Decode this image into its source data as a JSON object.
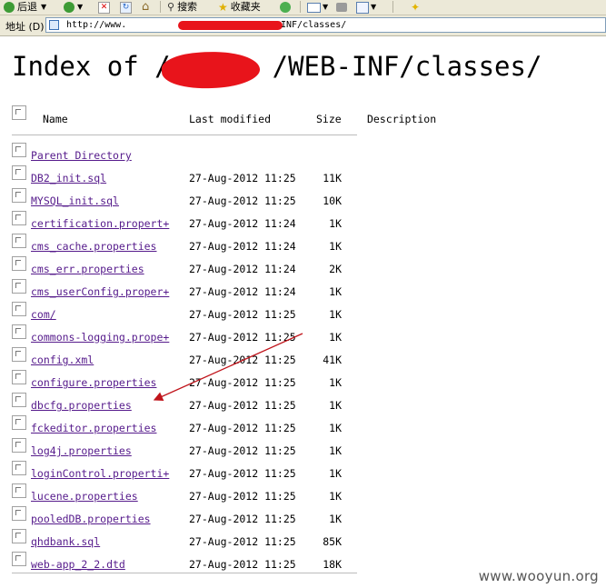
{
  "toolbar": {
    "back_label": "后退",
    "search_label": "搜索",
    "favorites_label": "收藏夹"
  },
  "address_bar": {
    "label": "地址 (D)",
    "url_prefix": "http://www.",
    "url_suffix": "INF/classes/"
  },
  "page": {
    "heading_prefix": "Index of /",
    "heading_suffix": "/WEB-INF/classes/"
  },
  "columns": {
    "name": "Name",
    "last_modified": "Last modified",
    "size": "Size",
    "description": "Description"
  },
  "files": [
    {
      "name": "Parent Directory",
      "modified": "",
      "size": ""
    },
    {
      "name": "DB2_init.sql",
      "modified": "27-Aug-2012 11:25",
      "size": "11K"
    },
    {
      "name": "MYSQL_init.sql",
      "modified": "27-Aug-2012 11:25",
      "size": "10K"
    },
    {
      "name": "certification.propert+",
      "modified": "27-Aug-2012 11:24",
      "size": "1K"
    },
    {
      "name": "cms_cache.properties",
      "modified": "27-Aug-2012 11:24",
      "size": "1K"
    },
    {
      "name": "cms_err.properties",
      "modified": "27-Aug-2012 11:24",
      "size": "2K"
    },
    {
      "name": "cms_userConfig.proper+",
      "modified": "27-Aug-2012 11:24",
      "size": "1K"
    },
    {
      "name": "com/",
      "modified": "27-Aug-2012 11:25",
      "size": "1K"
    },
    {
      "name": "commons-logging.prope+",
      "modified": "27-Aug-2012 11:25",
      "size": "1K"
    },
    {
      "name": "config.xml",
      "modified": "27-Aug-2012 11:25",
      "size": "41K"
    },
    {
      "name": "configure.properties",
      "modified": "27-Aug-2012 11:25",
      "size": "1K"
    },
    {
      "name": "dbcfg.properties",
      "modified": "27-Aug-2012 11:25",
      "size": "1K"
    },
    {
      "name": "fckeditor.properties",
      "modified": "27-Aug-2012 11:25",
      "size": "1K"
    },
    {
      "name": "log4j.properties",
      "modified": "27-Aug-2012 11:25",
      "size": "1K"
    },
    {
      "name": "loginControl.properti+",
      "modified": "27-Aug-2012 11:25",
      "size": "1K"
    },
    {
      "name": "lucene.properties",
      "modified": "27-Aug-2012 11:25",
      "size": "1K"
    },
    {
      "name": "pooledDB.properties",
      "modified": "27-Aug-2012 11:25",
      "size": "1K"
    },
    {
      "name": "qhdbank.sql",
      "modified": "27-Aug-2012 11:25",
      "size": "85K"
    },
    {
      "name": "web-app_2_2.dtd",
      "modified": "27-Aug-2012 11:25",
      "size": "18K"
    }
  ],
  "watermark": "www.wooyun.org",
  "colors": {
    "link": "#551a8b",
    "redaction": "#e8141b",
    "arrow": "#c0141b",
    "chrome": "#ece9d8"
  }
}
